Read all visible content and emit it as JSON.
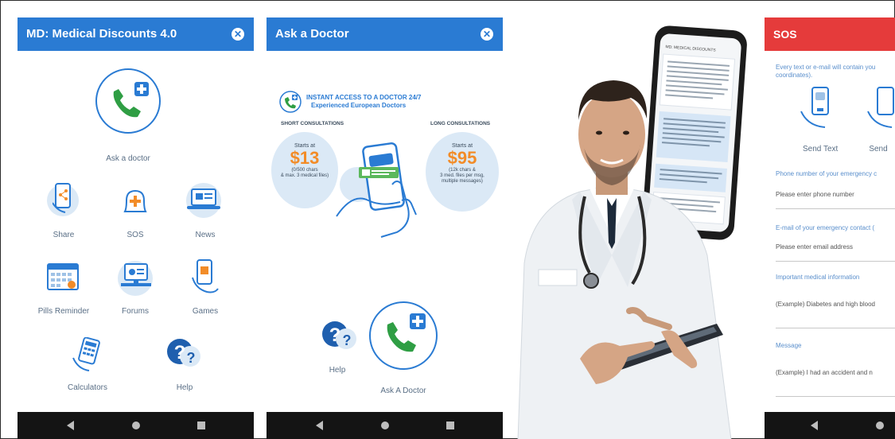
{
  "panel1": {
    "title": "MD: Medical Discounts 4.0",
    "close_glyph": "✕",
    "hero_label": "Ask a doctor",
    "items": [
      {
        "label": "Share"
      },
      {
        "label": "SOS"
      },
      {
        "label": "News"
      },
      {
        "label": "Pills Reminder"
      },
      {
        "label": "Forums"
      },
      {
        "label": "Games"
      },
      {
        "label": "Calculators"
      },
      {
        "label": "Help"
      }
    ]
  },
  "panel2": {
    "title": "Ask a Doctor",
    "close_glyph": "✕",
    "headline1": "INSTANT ACCESS TO A DOCTOR 24/7",
    "headline2": "Experienced European Doctors",
    "short": {
      "title": "SHORT CONSULTATIONS",
      "starts_at": "Starts at",
      "price": "$13",
      "desc1": "(0/500 chars",
      "desc2": "& max. 3 medical files)"
    },
    "long": {
      "title": "LONG CONSULTATIONS",
      "starts_at": "Starts at",
      "price": "$95",
      "desc1": "(12k chars &",
      "desc2": "3 med. files per msg,",
      "desc3": "multiple messages)"
    },
    "help_label": "Help",
    "ask_label": "Ask A Doctor"
  },
  "phone_screen": {
    "header": "MD: MEDICAL DISCOUNTS"
  },
  "panel4": {
    "title": "SOS",
    "intro1": "Every text or e-mail will contain you",
    "intro2": "coordinates).",
    "send_text": "Send Text",
    "send_other": "Send",
    "phone_label": "Phone number of your emergency c",
    "phone_placeholder": "Please enter phone number",
    "email_label": "E-mail of your emergency contact (",
    "email_placeholder": "Please enter email address",
    "medical_label": "Important medical information",
    "medical_value": "(Example) Diabetes and high blood",
    "message_label": "Message",
    "message_value": "(Example) I had an accident and n"
  },
  "colors": {
    "brand_blue": "#2a7bd3",
    "sos_red": "#e53b3b",
    "accent_green": "#2f9e44",
    "price_orange": "#f28c28"
  }
}
